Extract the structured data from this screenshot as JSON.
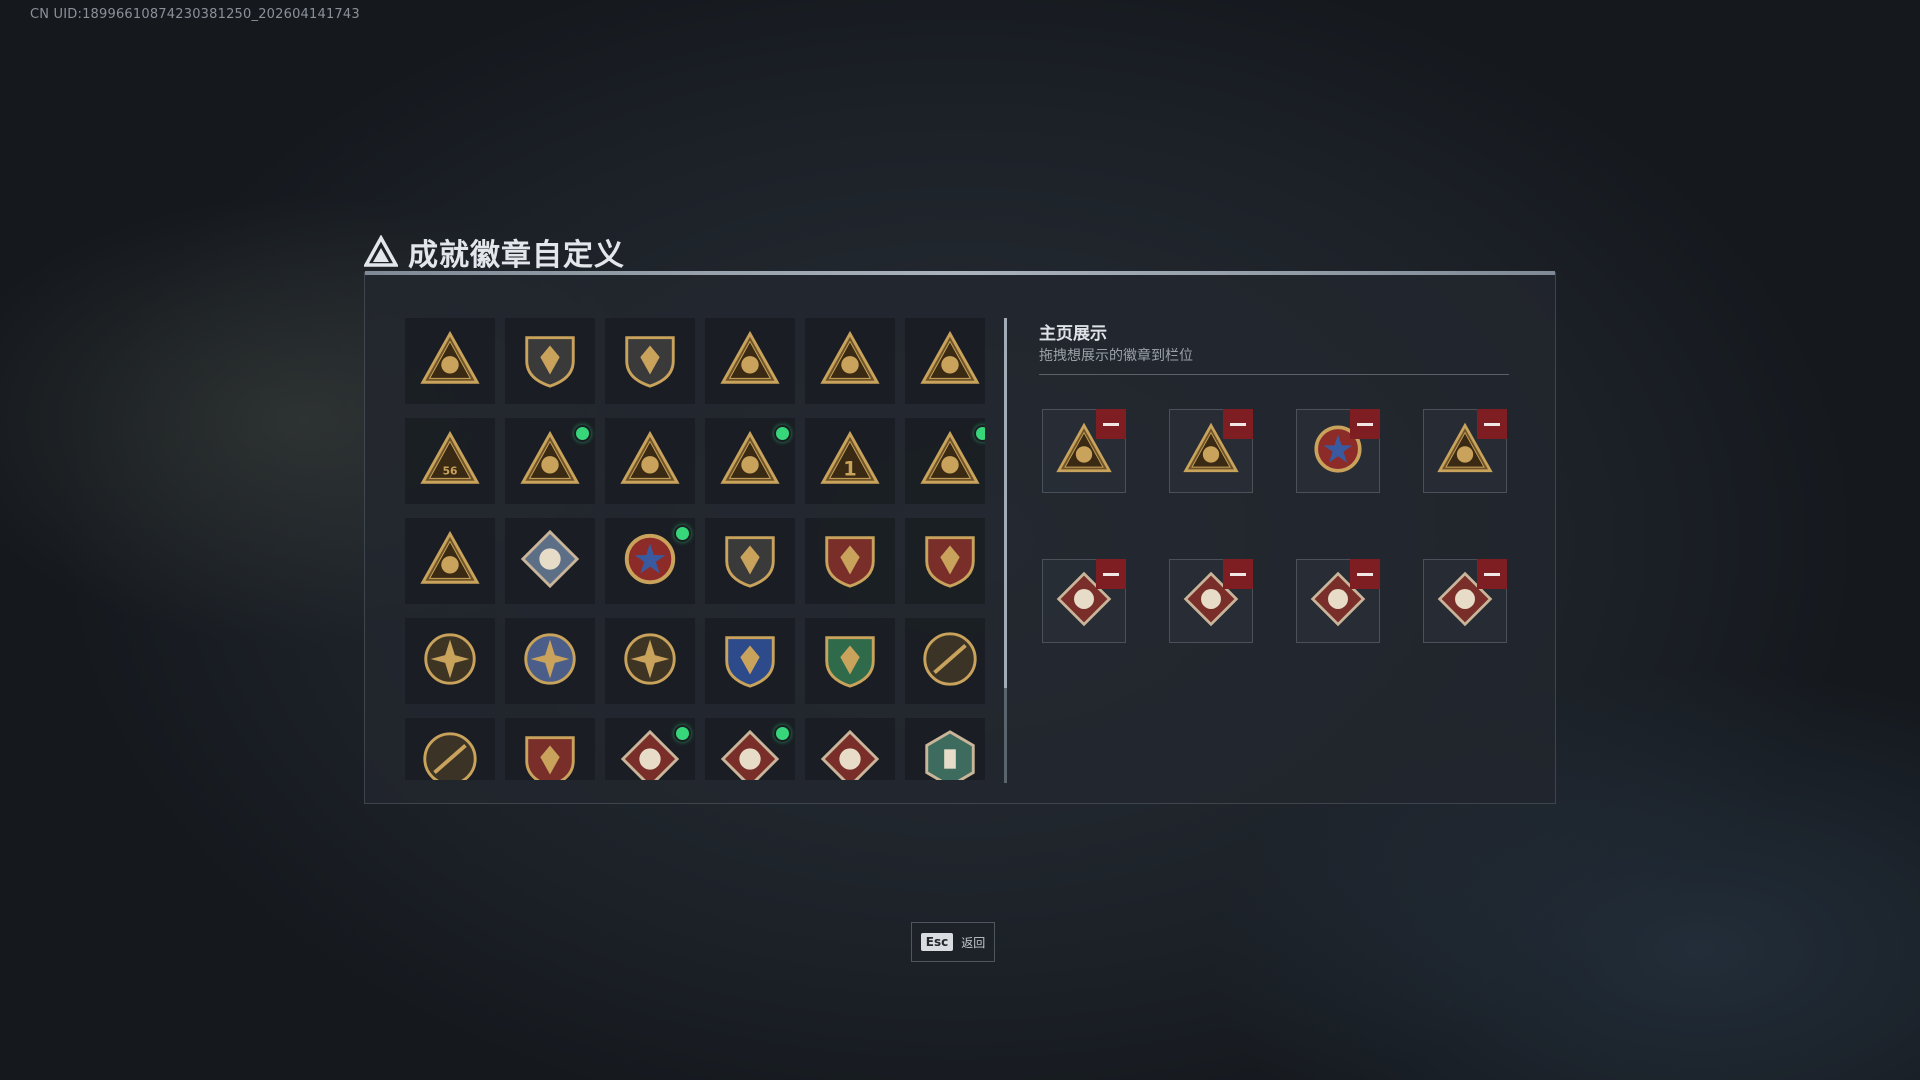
{
  "header": {
    "uid": "CN UID:18996610874230381250_202604141743",
    "title": "成就徽章自定义"
  },
  "badges": [
    {
      "icon": "shield-triangle-badge-icon",
      "new": false
    },
    {
      "icon": "helicopter-shield-badge-icon",
      "new": false
    },
    {
      "icon": "blade-shield-badge-icon",
      "new": false
    },
    {
      "icon": "gear-triangle-badge-icon",
      "new": false
    },
    {
      "icon": "vehicle-triangle-badge-icon",
      "new": false
    },
    {
      "icon": "flask-55-triangle-badge-icon",
      "new": false
    },
    {
      "icon": "56-triangle-badge-icon",
      "new": false
    },
    {
      "icon": "skull-triangle-badge-icon",
      "new": true
    },
    {
      "icon": "helmet-triangle-badge-icon",
      "new": false
    },
    {
      "icon": "soldier-triangle-badge-icon",
      "new": true
    },
    {
      "icon": "number-one-triangle-badge-icon",
      "new": false
    },
    {
      "icon": "crate-triangle-badge-icon",
      "new": true
    },
    {
      "icon": "squad-triangle-badge-icon",
      "new": false
    },
    {
      "icon": "rocket-diamond-badge-icon",
      "new": false
    },
    {
      "icon": "star-medal-badge-icon",
      "new": true
    },
    {
      "icon": "wings-shield-badge-icon",
      "new": false
    },
    {
      "icon": "crest-stars-badge-icon",
      "new": false
    },
    {
      "icon": "green-crest-badge-icon",
      "new": false
    },
    {
      "icon": "crosshair-skull-badge-icon",
      "new": false
    },
    {
      "icon": "blue-emblem-badge-icon",
      "new": false
    },
    {
      "icon": "compass-star-badge-icon",
      "new": false
    },
    {
      "icon": "sniper-blue-shield-badge-icon",
      "new": false
    },
    {
      "icon": "rifle-green-shield-badge-icon",
      "new": false
    },
    {
      "icon": "rifle-circle-badge-icon",
      "new": false
    },
    {
      "icon": "sniper-circle-badge-icon",
      "new": false
    },
    {
      "icon": "rifles-crest-badge-icon",
      "new": false
    },
    {
      "icon": "wolf-diamond-badge-icon",
      "new": true
    },
    {
      "icon": "wolf-diamond-badge-icon",
      "new": true
    },
    {
      "icon": "eagle-diamond-badge-icon",
      "new": false
    },
    {
      "icon": "soldier-hex-badge-icon",
      "new": false
    }
  ],
  "showcase": {
    "title": "主页展示",
    "subtitle": "拖拽想展示的徽章到栏位",
    "slots": [
      {
        "icon": "skull-triangle-badge-icon"
      },
      {
        "icon": "soldier-triangle-badge-icon"
      },
      {
        "icon": "star-medal-badge-icon"
      },
      {
        "icon": "crate-triangle-badge-icon"
      },
      {
        "icon": "wolf-diamond-badge-icon"
      },
      {
        "icon": "wolf-diamond-badge-icon"
      },
      {
        "icon": "dragon-diamond-badge-icon"
      },
      {
        "icon": "dragon-diamond-badge-icon"
      }
    ]
  },
  "footer": {
    "esc_key": "Esc",
    "esc_label": "返回"
  },
  "colors": {
    "gold": "#c9a35c",
    "dark_gold": "#6e5326",
    "red": "#7f1e22",
    "green_dot": "#37d67a"
  }
}
